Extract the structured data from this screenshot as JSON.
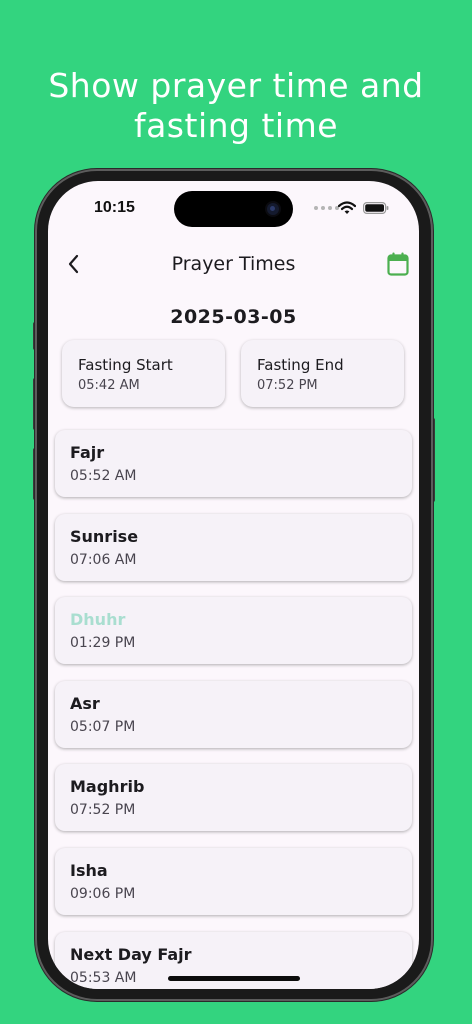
{
  "headline": {
    "line1": "Show prayer time and",
    "line2": "fasting time"
  },
  "status_bar": {
    "time": "10:15"
  },
  "app_bar": {
    "title": "Prayer Times",
    "back_icon": "chevron-left-icon",
    "calendar_icon": "calendar-icon"
  },
  "date": "2025-03-05",
  "fasting": {
    "start": {
      "label": "Fasting Start",
      "time": "05:42 AM"
    },
    "end": {
      "label": "Fasting End",
      "time": "07:52 PM"
    }
  },
  "prayers": [
    {
      "name": "Fajr",
      "time": "05:52 AM"
    },
    {
      "name": "Sunrise",
      "time": "07:06 AM"
    },
    {
      "name": "Dhuhr",
      "time": "01:29 PM"
    },
    {
      "name": "Asr",
      "time": "05:07 PM"
    },
    {
      "name": "Maghrib",
      "time": "07:52 PM"
    },
    {
      "name": "Isha",
      "time": "09:06 PM"
    },
    {
      "name": "Next Day Fajr",
      "time": "05:53 AM"
    }
  ],
  "colors": {
    "background": "#33d47f",
    "accent": "#4caf50",
    "current_prayer": "#a9ded0",
    "screen": "#fcf7fc",
    "card": "#f6f2f8"
  }
}
